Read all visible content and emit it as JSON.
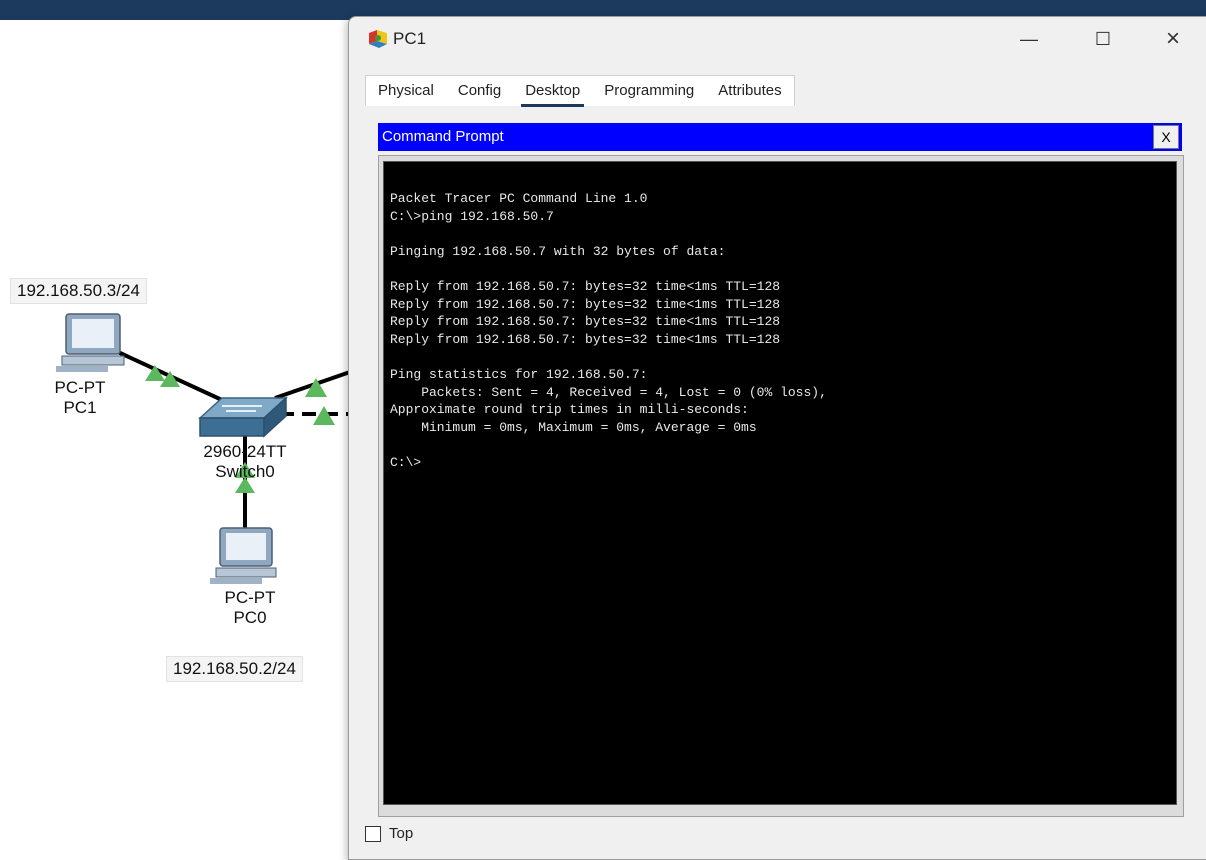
{
  "workspace": {
    "pc1": {
      "ip": "192.168.50.3/24",
      "model": "PC-PT",
      "name": "PC1"
    },
    "switch": {
      "model": "2960-24TT",
      "name": "Switch0"
    },
    "pc0": {
      "ip": "192.168.50.2/24",
      "model": "PC-PT",
      "name": "PC0"
    }
  },
  "window": {
    "title": "PC1",
    "tabs": [
      {
        "label": "Physical"
      },
      {
        "label": "Config"
      },
      {
        "label": "Desktop"
      },
      {
        "label": "Programming"
      },
      {
        "label": "Attributes"
      }
    ],
    "active_tab": "Desktop",
    "close_glyph": "×",
    "maximize_glyph": "☐",
    "minimize_glyph": "—",
    "top_checkbox_label": "Top"
  },
  "command_prompt": {
    "title": "Command Prompt",
    "close_glyph": "X",
    "lines": [
      "Packet Tracer PC Command Line 1.0",
      "C:\\>ping 192.168.50.7",
      "",
      "Pinging 192.168.50.7 with 32 bytes of data:",
      "",
      "Reply from 192.168.50.7: bytes=32 time<1ms TTL=128",
      "Reply from 192.168.50.7: bytes=32 time<1ms TTL=128",
      "Reply from 192.168.50.7: bytes=32 time<1ms TTL=128",
      "Reply from 192.168.50.7: bytes=32 time<1ms TTL=128",
      "",
      "Ping statistics for 192.168.50.7:",
      "    Packets: Sent = 4, Received = 4, Lost = 0 (0% loss),",
      "Approximate round trip times in milli-seconds:",
      "    Minimum = 0ms, Maximum = 0ms, Average = 0ms",
      "",
      "C:\\>"
    ]
  },
  "colors": {
    "cmd_header": "#0000ff",
    "terminal_bg": "#000000",
    "link_up": "#5cb85c",
    "topbar": "#1b3a5e"
  }
}
